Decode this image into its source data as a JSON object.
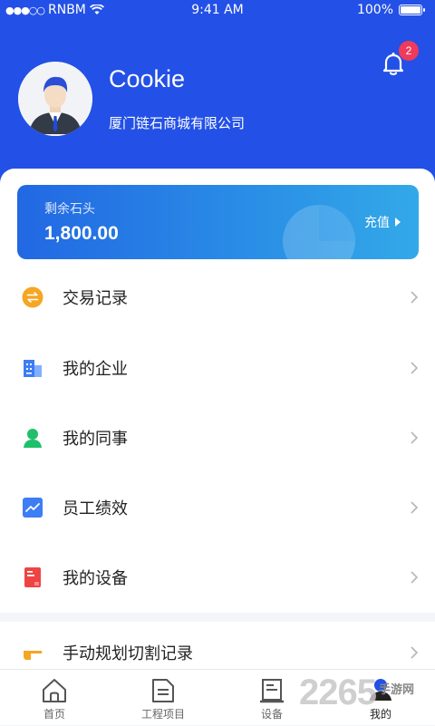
{
  "status_bar": {
    "carrier": "RNBM",
    "time": "9:41 AM",
    "battery": "100%"
  },
  "profile": {
    "name": "Cookie",
    "company": "厦门链石商城有限公司",
    "notification_count": "2"
  },
  "balance_card": {
    "label": "剩余石头",
    "value": "1,800.00",
    "recharge_label": "充值"
  },
  "menu": {
    "items": [
      {
        "label": "交易记录",
        "icon": "exchange-icon",
        "color": "#f5a623"
      },
      {
        "label": "我的企业",
        "icon": "building-icon",
        "color": "#3d7df5"
      },
      {
        "label": "我的同事",
        "icon": "person-icon",
        "color": "#1fbf6b"
      },
      {
        "label": "员工绩效",
        "icon": "chart-icon",
        "color": "#3d7df5"
      },
      {
        "label": "我的设备",
        "icon": "device-icon",
        "color": "#ef4444"
      },
      {
        "label": "手动规划切割记录",
        "icon": "pointing-hand-icon",
        "color": "#f5a623"
      }
    ]
  },
  "tabbar": {
    "tabs": [
      {
        "label": "首页",
        "icon": "home-icon"
      },
      {
        "label": "工程项目",
        "icon": "document-icon"
      },
      {
        "label": "设备",
        "icon": "equipment-icon"
      },
      {
        "label": "我的",
        "icon": "profile-icon",
        "active": true
      }
    ]
  },
  "watermark": {
    "number": "2265",
    "text": "手游网"
  },
  "colors": {
    "header_blue": "#2350e6",
    "card_gradient_start": "#2268e3",
    "card_gradient_end": "#33a9e8",
    "badge_red": "#ef3a5c"
  }
}
